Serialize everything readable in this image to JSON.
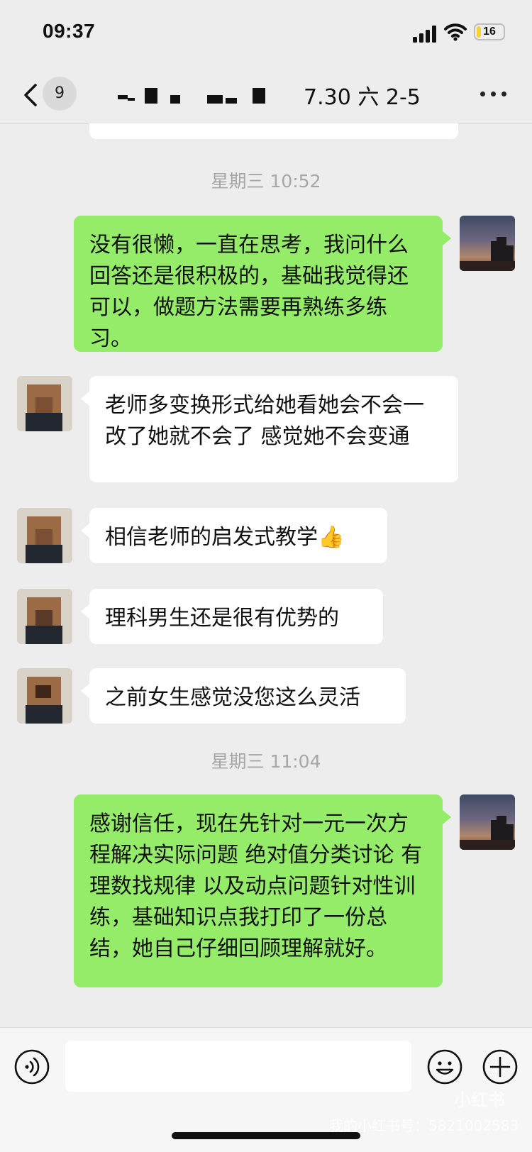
{
  "status_bar": {
    "time": "09:37",
    "battery_level": "16"
  },
  "nav": {
    "unread_count": "9",
    "title": "7.30 六 2-5"
  },
  "chat": {
    "timestamps": [
      "星期三 10:52",
      "星期三 11:04"
    ],
    "messages": [
      {
        "from": "self",
        "text": "没有很懒，一直在思考，我问什么回答还是很积极的，基础我觉得还可以，做题方法需要再熟练多练习。"
      },
      {
        "from": "other",
        "text": "老师多变换形式给她看她会不会一改了她就不会了 感觉她不会变通"
      },
      {
        "from": "other",
        "text": "相信老师的启发式教学"
      },
      {
        "from": "other",
        "text": "理科男生还是很有优势的"
      },
      {
        "from": "other",
        "text": "之前女生感觉没您这么灵活"
      },
      {
        "from": "self",
        "text": "感谢信任，现在先针对一元一次方程解决实际问题 绝对值分类讨论 有理数找规律 以及动点问题针对性训练，基础知识点我打印了一份总结，她自己仔细回顾理解就好。"
      }
    ]
  },
  "input": {
    "placeholder": ""
  },
  "watermark": {
    "logo": "小红书",
    "text": "我的小红书号：5821002583"
  },
  "colors": {
    "self_bubble": "#95ec69",
    "other_bubble": "#ffffff",
    "background": "#ededed"
  },
  "icons": [
    "back-arrow-icon",
    "more-dots-icon",
    "voice-icon",
    "emoji-icon",
    "plus-icon",
    "thumbs-up-icon"
  ]
}
